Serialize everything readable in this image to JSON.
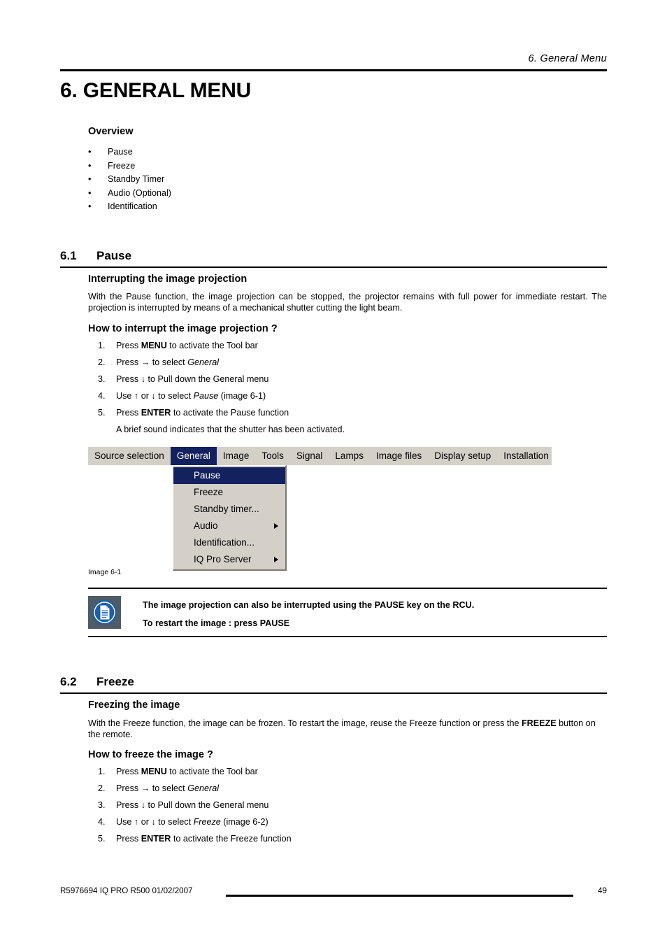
{
  "header": {
    "running_head": "6.  General Menu",
    "chapter_title": "6. GENERAL MENU"
  },
  "overview": {
    "heading": "Overview",
    "items": [
      {
        "bullet": "•",
        "label": "Pause"
      },
      {
        "bullet": "•",
        "label": "Freeze"
      },
      {
        "bullet": "•",
        "label": "Standby Timer"
      },
      {
        "bullet": "•",
        "label": "Audio (Optional)"
      },
      {
        "bullet": "•",
        "label": "Identification"
      }
    ]
  },
  "section_pause": {
    "number": "6.1",
    "title": "Pause",
    "sub1_heading": "Interrupting the image projection",
    "sub1_paragraph": "With the Pause function, the image projection can be stopped, the projector remains with full power for immediate restart.  The projection is interrupted by means of a mechanical shutter cutting the light beam.",
    "sub2_heading": "How to interrupt the image projection ?",
    "steps": [
      {
        "num": "1.",
        "text_html": "Press <b>MENU</b> to activate the Tool bar"
      },
      {
        "num": "2.",
        "text_html": "Press → to select <i>General</i>"
      },
      {
        "num": "3.",
        "text_html": "Press ↓ to Pull down the General menu"
      },
      {
        "num": "4.",
        "text_html": "Use ↑ or ↓ to select <i>Pause</i> (image 6-1)"
      },
      {
        "num": "5.",
        "text_html": "Press <b>ENTER</b> to activate the Pause function"
      }
    ],
    "steps_note": "A brief sound indicates that the shutter has been activated.",
    "figure_caption": "Image 6-1"
  },
  "menu_screenshot": {
    "menubar_items": [
      {
        "label": "Source selection",
        "active": false
      },
      {
        "label": "General",
        "active": true
      },
      {
        "label": "Image",
        "active": false
      },
      {
        "label": "Tools",
        "active": false
      },
      {
        "label": "Signal",
        "active": false
      },
      {
        "label": "Lamps",
        "active": false
      },
      {
        "label": "Image files",
        "active": false
      },
      {
        "label": "Display setup",
        "active": false
      },
      {
        "label": "Installation",
        "active": false
      }
    ],
    "dropdown_items": [
      {
        "label": "Pause",
        "selected": true,
        "submenu": false
      },
      {
        "label": "Freeze",
        "selected": false,
        "submenu": false
      },
      {
        "label": "Standby timer...",
        "selected": false,
        "submenu": false
      },
      {
        "label": "Audio",
        "selected": false,
        "submenu": true
      },
      {
        "label": "Identification...",
        "selected": false,
        "submenu": false
      },
      {
        "label": "IQ Pro Server",
        "selected": false,
        "submenu": true
      }
    ],
    "colors": {
      "menu_background": "#d4d0c8",
      "highlight": "#13215e",
      "highlight_text": "#ffffff",
      "text": "#000000"
    }
  },
  "note": {
    "icon_name": "note-document-icon",
    "icon_colors": {
      "background": "#4f5b66",
      "circle": "#1a5fa8",
      "page": "#ffffff"
    },
    "line1": "The image projection can also be interrupted using the PAUSE key on the RCU.",
    "line2": "To restart the image :  press PAUSE"
  },
  "section_freeze": {
    "number": "6.2",
    "title": "Freeze",
    "sub1_heading": "Freezing the image",
    "sub1_paragraph_a": "With the Freeze function, the image can be frozen. To restart the image, reuse the Freeze function or press the ",
    "sub1_paragraph_b": "FREEZE",
    "sub1_paragraph_c": " button on the remote.",
    "sub2_heading": "How to freeze the image ?",
    "steps": [
      {
        "num": "1.",
        "text_html": "Press <b>MENU</b> to activate the Tool bar"
      },
      {
        "num": "2.",
        "text_html": "Press → to select <i>General</i>"
      },
      {
        "num": "3.",
        "text_html": "Press ↓ to Pull down the General menu"
      },
      {
        "num": "4.",
        "text_html": "Use ↑ or ↓ to select <i>Freeze</i> (image 6-2)"
      },
      {
        "num": "5.",
        "text_html": "Press <b>ENTER</b> to activate the Freeze function"
      }
    ]
  },
  "footer": {
    "left": "R5976694  IQ PRO R500  01/02/2007",
    "page_number": "49"
  }
}
